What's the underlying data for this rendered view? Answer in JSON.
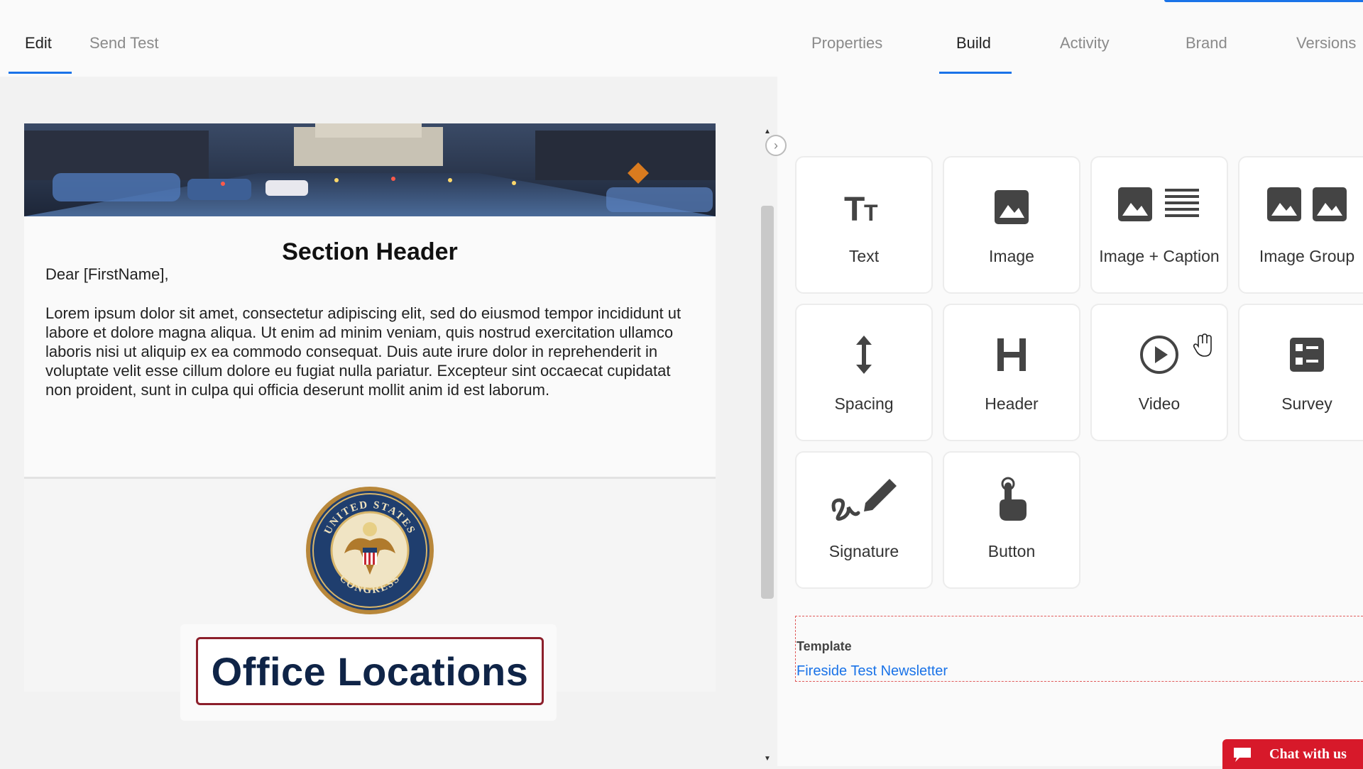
{
  "nav": {
    "left_tabs": [
      {
        "label": "Edit",
        "active": true
      },
      {
        "label": "Send Test",
        "active": false
      }
    ],
    "right_tabs": [
      {
        "label": "Properties",
        "active": false
      },
      {
        "label": "Build",
        "active": true
      },
      {
        "label": "Activity",
        "active": false
      },
      {
        "label": "Brand",
        "active": false
      },
      {
        "label": "Versions",
        "active": false
      }
    ]
  },
  "email": {
    "section_header": "Section Header",
    "salutation": "Dear [FirstName],",
    "body": "Lorem ipsum dolor sit amet, consectetur adipiscing elit, sed do eiusmod tempor incididunt ut labore et dolore magna aliqua. Ut enim ad minim veniam, quis nostrud exercitation ullamco laboris nisi ut aliquip ex ea commodo consequat. Duis aute irure dolor in reprehenderit in voluptate velit esse cillum dolore eu fugiat nulla pariatur. Excepteur sint occaecat cupidatat non proident, sunt in culpa qui officia deserunt mollit anim id est laborum.",
    "seal_text_top": "UNITED STATES",
    "seal_text_bottom": "CONGRESS",
    "office_locations": "Office Locations"
  },
  "blocks": [
    {
      "label": "Text",
      "icon": "text-size-icon"
    },
    {
      "label": "Image",
      "icon": "image-icon"
    },
    {
      "label": "Image + Caption",
      "icon": "image-caption-icon"
    },
    {
      "label": "Image Group",
      "icon": "image-group-icon"
    },
    {
      "label": "Spacing",
      "icon": "vertical-arrows-icon"
    },
    {
      "label": "Header",
      "icon": "header-h-icon"
    },
    {
      "label": "Video",
      "icon": "play-circle-icon"
    },
    {
      "label": "Survey",
      "icon": "survey-icon"
    },
    {
      "label": "Signature",
      "icon": "signature-pen-icon"
    },
    {
      "label": "Button",
      "icon": "tap-finger-icon"
    }
  ],
  "template": {
    "title": "Template",
    "name": "Fireside Test Newsletter"
  },
  "chat": {
    "label": "Chat with us"
  },
  "colors": {
    "accent": "#1a73e8",
    "chat": "#d7192a",
    "office_border": "#8c1f2b",
    "office_text": "#0f2447"
  }
}
